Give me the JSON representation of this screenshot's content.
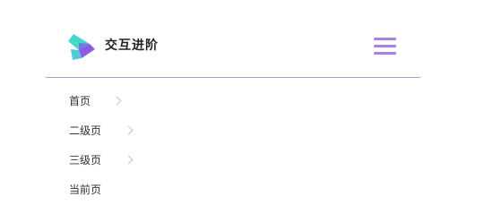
{
  "header": {
    "logo_icon": "brand-logo-icon",
    "title": "交互进阶",
    "menu_icon": "hamburger-menu-icon",
    "accent_color": "#a983e8"
  },
  "breadcrumb": {
    "items": [
      {
        "label": "首页",
        "has_chevron": true
      },
      {
        "label": "二级页",
        "has_chevron": true
      },
      {
        "label": "三级页",
        "has_chevron": true
      },
      {
        "label": "当前页",
        "has_chevron": false
      }
    ],
    "chevron_icon": "chevron-right-icon"
  }
}
